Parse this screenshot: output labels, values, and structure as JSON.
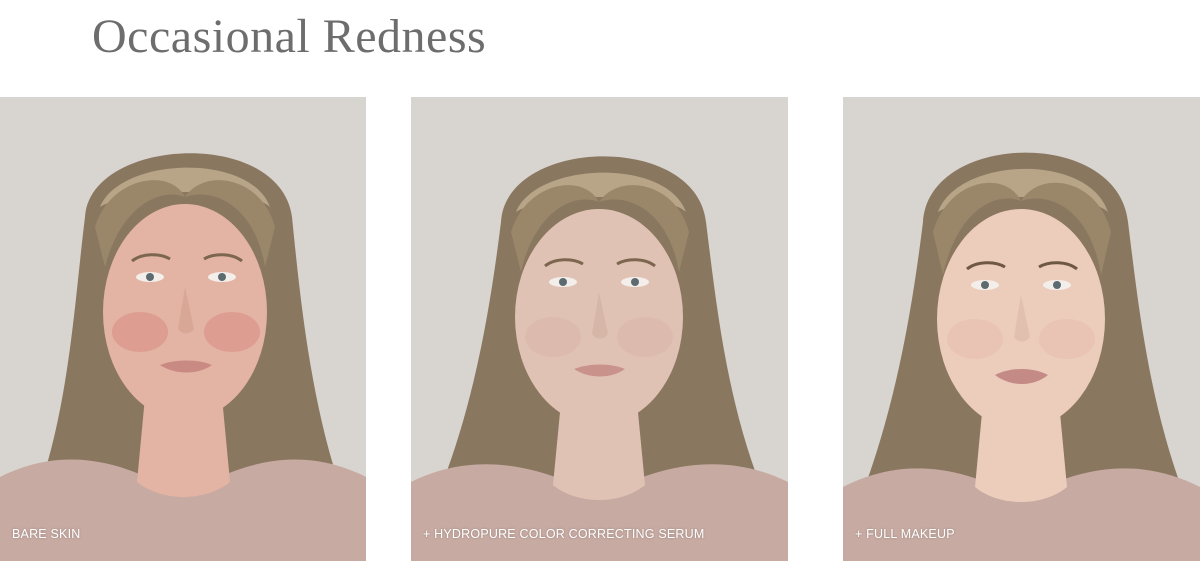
{
  "page": {
    "title": "Occasional Redness"
  },
  "panels": [
    {
      "caption": "BARE SKIN",
      "skin_color": "#e3b3a3",
      "cheek_color": "#d98a82"
    },
    {
      "caption": "+ HYDROPURE COLOR CORRECTING SERUM",
      "skin_color": "#e0c2b4",
      "cheek_color": "#d9b2a8"
    },
    {
      "caption": "+ FULL MAKEUP",
      "skin_color": "#ecccbb",
      "cheek_color": "#e6bcae"
    }
  ],
  "colors": {
    "title": "#6d6d6d",
    "background_wall": "#d8d4cf",
    "hair": "#8a7760",
    "hair_highlight": "#b8a587",
    "shirt": "#c7aaa2",
    "caption_text": "#ffffff"
  }
}
